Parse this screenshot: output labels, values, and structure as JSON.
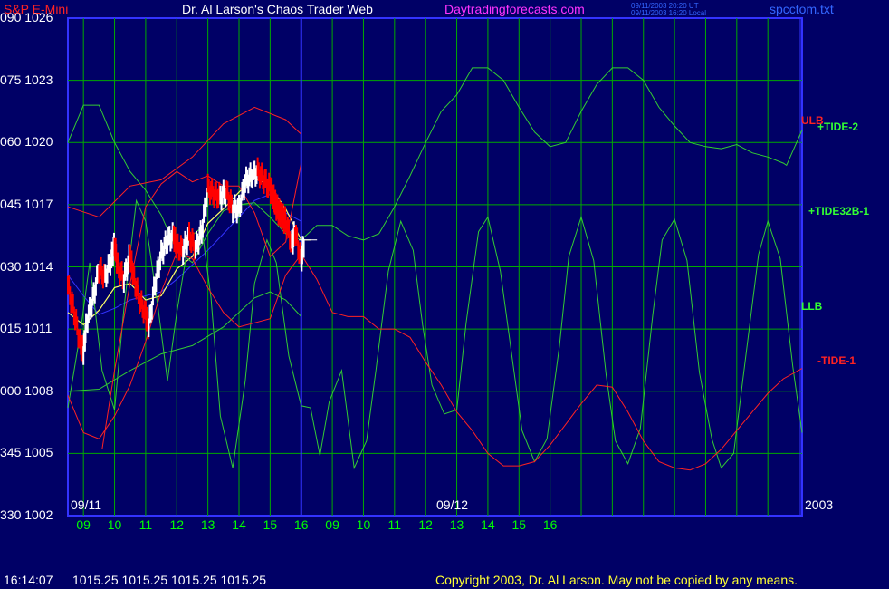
{
  "header": {
    "symbol": "S&P E-Mini",
    "title": "Dr. Al Larson's Chaos Trader Web",
    "site": "Daytradingforecasts.com",
    "stamp1": "09/11/2003 20:20 UT",
    "stamp2": "09/11/2003 16:20 Local",
    "file": "spcctom.txt"
  },
  "footer": {
    "time": "16:14:07",
    "quotes": "1015.25 1015.25 1015.25 1015.25",
    "copyright": "Copyright 2003, Dr. Al Larson. May not be copied by any means."
  },
  "colors": {
    "background": "#000066",
    "grid": "#00aa00",
    "price_up": "#ffffff",
    "price_down": "#ff0000",
    "green_line": "#33cc33",
    "red_line": "#ff2222",
    "blue_line": "#3333ff",
    "yellow_line": "#ffff66"
  },
  "chart_data": {
    "type": "line",
    "title": "S&P E-Mini",
    "ylabels": [
      {
        "deg": "090",
        "price": "1026"
      },
      {
        "deg": "075",
        "price": "1023"
      },
      {
        "deg": "060",
        "price": "1020"
      },
      {
        "deg": "045",
        "price": "1017"
      },
      {
        "deg": "030",
        "price": "1014"
      },
      {
        "deg": "015",
        "price": "1011"
      },
      {
        "deg": "000",
        "price": "1008"
      },
      {
        "deg": "345",
        "price": "1005"
      },
      {
        "deg": "330",
        "price": "1002"
      }
    ],
    "ylim": [
      1002,
      1026
    ],
    "xlabels": [
      "09",
      "10",
      "11",
      "12",
      "13",
      "14",
      "15",
      "16",
      "09",
      "10",
      "11",
      "12",
      "13",
      "14",
      "15",
      "16"
    ],
    "xlim": [
      8.5,
      32.1
    ],
    "day_labels": [
      "09/11",
      "09/12",
      "2003"
    ],
    "right_labels": [
      {
        "text": "ULB",
        "color": "#ff2222"
      },
      {
        "text": "+TIDE-2",
        "color": "#33ff33"
      },
      {
        "text": "+TIDE32B-1",
        "color": "#33ff33"
      },
      {
        "text": "LLB",
        "color": "#33ff33"
      },
      {
        "text": "-TIDE-1",
        "color": "#ff2222"
      }
    ],
    "series": [
      {
        "name": "ULB",
        "color": "#ff2222",
        "x": [
          8.5,
          9.5,
          10.5,
          11.5,
          12.5,
          13.5,
          14.5,
          15.5,
          16.0
        ],
        "y": [
          1016.9,
          1016.4,
          1017.9,
          1018.2,
          1019.3,
          1020.9,
          1021.7,
          1021.1,
          1020.4
        ]
      },
      {
        "name": "+TIDE-2",
        "color": "#33cc33",
        "x": [
          8.5,
          9.0,
          9.5,
          10.0,
          10.5,
          11.0,
          11.5,
          12.0,
          12.5,
          13.0,
          13.5,
          14.0,
          14.5,
          15.0,
          15.5,
          16.0,
          16.5,
          17.0,
          17.5,
          18.0,
          18.5,
          19.0,
          19.5,
          20.0,
          20.5,
          21.0,
          21.5,
          22.0,
          22.5,
          23.0,
          23.5,
          24.0,
          24.5,
          25.0,
          25.5,
          26.0,
          26.5,
          27.0,
          27.5,
          28.0,
          28.5,
          29.0,
          29.5,
          30.0,
          30.5,
          31.0,
          31.5,
          31.6,
          32.1
        ],
        "y": [
          1020.0,
          1021.8,
          1021.8,
          1020.0,
          1018.6,
          1017.7,
          1016.5,
          1014.8,
          1014.2,
          1015.6,
          1016.7,
          1017.0,
          1017.1,
          1016.4,
          1015.6,
          1015.3,
          1016.0,
          1016.0,
          1015.5,
          1015.3,
          1015.6,
          1016.9,
          1018.4,
          1020.0,
          1021.5,
          1022.3,
          1023.6,
          1023.6,
          1023.0,
          1021.7,
          1020.5,
          1019.8,
          1020.0,
          1021.5,
          1022.8,
          1023.6,
          1023.6,
          1023.0,
          1021.7,
          1020.8,
          1020.0,
          1019.8,
          1019.7,
          1019.9,
          1019.5,
          1019.3,
          1019.0,
          1018.9,
          1020.6
        ]
      },
      {
        "name": "+TIDE32B-1",
        "color": "#33cc33",
        "x": [
          8.5,
          8.9,
          9.2,
          9.6,
          10.0,
          10.3,
          10.7,
          11.0,
          11.4,
          11.7,
          12.0,
          12.4,
          12.8,
          13.1,
          13.4,
          13.8,
          14.2,
          14.5,
          14.9,
          15.2,
          15.6,
          16.0,
          16.3,
          16.6,
          16.9,
          17.3,
          17.7,
          18.1,
          18.4,
          18.8,
          19.2,
          19.6,
          19.9,
          20.2,
          20.6,
          21.0,
          21.3,
          21.7,
          22.0,
          22.4,
          22.8,
          23.1,
          23.5,
          23.9,
          24.3,
          24.6,
          25.0,
          25.4,
          25.8,
          26.1,
          26.5,
          26.9,
          27.3,
          27.6,
          28.0,
          28.4,
          28.8,
          29.2,
          29.5,
          29.9,
          30.3,
          30.7,
          31.0,
          31.4,
          31.8,
          32.1
        ],
        "y": [
          1007.2,
          1010.8,
          1014.2,
          1009.0,
          1007.1,
          1012.0,
          1017.2,
          1016.2,
          1012.0,
          1008.5,
          1011.8,
          1015.4,
          1015.9,
          1012.5,
          1006.8,
          1004.3,
          1008.5,
          1013.2,
          1015.3,
          1014.2,
          1009.7,
          1007.3,
          1007.2,
          1004.9,
          1007.5,
          1009.0,
          1004.3,
          1005.6,
          1009.0,
          1013.8,
          1016.2,
          1014.8,
          1011.2,
          1008.3,
          1006.9,
          1007.1,
          1011.3,
          1015.7,
          1016.4,
          1013.8,
          1009.4,
          1006.1,
          1004.6,
          1005.7,
          1010.2,
          1014.5,
          1016.4,
          1014.3,
          1008.8,
          1005.6,
          1004.5,
          1006.2,
          1011.7,
          1015.3,
          1016.3,
          1014.3,
          1008.9,
          1005.7,
          1004.3,
          1005.0,
          1009.8,
          1014.6,
          1016.2,
          1014.4,
          1009.2,
          1006.0
        ]
      },
      {
        "name": "LLB",
        "color": "#33cc33",
        "x": [
          8.5,
          9.5,
          10.5,
          11.5,
          12.5,
          13.5,
          14.5,
          15.0,
          15.5,
          16.0
        ],
        "y": [
          1008.0,
          1008.1,
          1009.0,
          1009.8,
          1010.2,
          1011.1,
          1012.5,
          1012.8,
          1012.4,
          1011.6
        ]
      },
      {
        "name": "-TIDE-1",
        "color": "#ff2222",
        "x": [
          8.5,
          9.0,
          9.5,
          10.0,
          10.5,
          11.0,
          11.5,
          12.0,
          12.5,
          13.0,
          13.5,
          14.0,
          14.5,
          15.0,
          15.5,
          16.0,
          16.5,
          17.0,
          17.5,
          18.0,
          18.5,
          19.0,
          19.5,
          20.0,
          20.5,
          21.0,
          21.5,
          22.0,
          22.5,
          23.0,
          23.5,
          24.0,
          24.5,
          25.0,
          25.5,
          26.0,
          26.5,
          27.0,
          27.5,
          28.0,
          28.5,
          29.0,
          29.5,
          30.0,
          30.5,
          31.0,
          31.5,
          32.1
        ],
        "y": [
          1007.8,
          1006.0,
          1005.7,
          1006.8,
          1008.3,
          1010.4,
          1012.8,
          1014.7,
          1014.4,
          1013.0,
          1011.8,
          1011.1,
          1011.3,
          1011.5,
          1013.6,
          1014.6,
          1013.4,
          1011.8,
          1011.6,
          1011.6,
          1011.0,
          1011.0,
          1010.6,
          1009.4,
          1008.3,
          1007.0,
          1006.1,
          1005.0,
          1004.4,
          1004.4,
          1004.6,
          1005.4,
          1006.4,
          1007.4,
          1008.3,
          1008.2,
          1007.0,
          1005.6,
          1004.6,
          1004.3,
          1004.2,
          1004.5,
          1005.2,
          1006.1,
          1007.0,
          1007.9,
          1008.6,
          1009.1
        ]
      },
      {
        "name": "Open ULB",
        "color": "#ff2222",
        "x": [
          9.6,
          10.0,
          10.5,
          11.0,
          11.5,
          12.0,
          12.5,
          13.0,
          13.5,
          14.0,
          14.5,
          15.0,
          15.5,
          16.0
        ],
        "y": [
          1005.2,
          1009.0,
          1013.2,
          1016.9,
          1018.0,
          1018.6,
          1018.1,
          1018.4,
          1017.9,
          1017.9,
          1016.6,
          1014.5,
          1015.2,
          1019.0
        ]
      },
      {
        "name": "Blue",
        "color": "#3333ff",
        "x": [
          8.5,
          9.0,
          9.5,
          10.0,
          10.5,
          11.0,
          11.5,
          12.0,
          12.5,
          13.0,
          13.5,
          14.0,
          14.5,
          15.0,
          15.5,
          16.0
        ],
        "y": [
          1013.6,
          1012.6,
          1011.7,
          1012.0,
          1012.4,
          1012.6,
          1012.8,
          1013.4,
          1014.1,
          1014.8,
          1015.6,
          1016.4,
          1017.2,
          1017.5,
          1016.6,
          1016.2
        ]
      },
      {
        "name": "Yellow",
        "color": "#ffff66",
        "x": [
          8.5,
          9.0,
          9.5,
          10.0,
          10.5,
          11.0,
          11.5,
          12.0,
          12.5,
          13.0,
          13.5,
          14.0,
          14.5,
          15.0,
          15.5,
          16.0,
          16.3
        ],
        "y": [
          1011.8,
          1011.2,
          1011.9,
          1013.0,
          1013.2,
          1012.4,
          1012.6,
          1013.9,
          1014.5,
          1016.1,
          1016.8,
          1017.6,
          1018.3,
          1017.9,
          1016.8,
          1015.3,
          1015.3
        ]
      },
      {
        "name": "Price",
        "color": "#ffffff",
        "x": [
          8.5,
          8.7,
          8.9,
          9.0,
          9.1,
          9.3,
          9.5,
          9.7,
          9.9,
          10.0,
          10.1,
          10.3,
          10.5,
          10.6,
          10.8,
          11.0,
          11.1,
          11.3,
          11.5,
          11.7,
          11.9,
          12.0,
          12.2,
          12.4,
          12.6,
          12.8,
          13.0,
          13.2,
          13.4,
          13.6,
          13.8,
          14.0,
          14.2,
          14.4,
          14.6,
          14.8,
          15.0,
          15.1,
          15.2,
          15.3,
          15.4,
          15.5,
          15.7,
          15.8,
          16.0,
          16.1
        ],
        "y": [
          1013.1,
          1011.8,
          1010.3,
          1009.9,
          1011.3,
          1012.4,
          1013.9,
          1013.5,
          1014.4,
          1015.1,
          1014.0,
          1013.4,
          1014.6,
          1013.6,
          1012.4,
          1011.7,
          1011.1,
          1013.2,
          1014.6,
          1015.3,
          1015.5,
          1015.0,
          1014.8,
          1015.5,
          1014.9,
          1015.7,
          1017.8,
          1017.5,
          1017.4,
          1017.6,
          1016.8,
          1016.8,
          1018.1,
          1018.4,
          1018.6,
          1018.2,
          1017.8,
          1017.4,
          1016.9,
          1016.6,
          1016.4,
          1016.2,
          1015.1,
          1015.7,
          1014.3,
          1015.3
        ]
      }
    ]
  }
}
